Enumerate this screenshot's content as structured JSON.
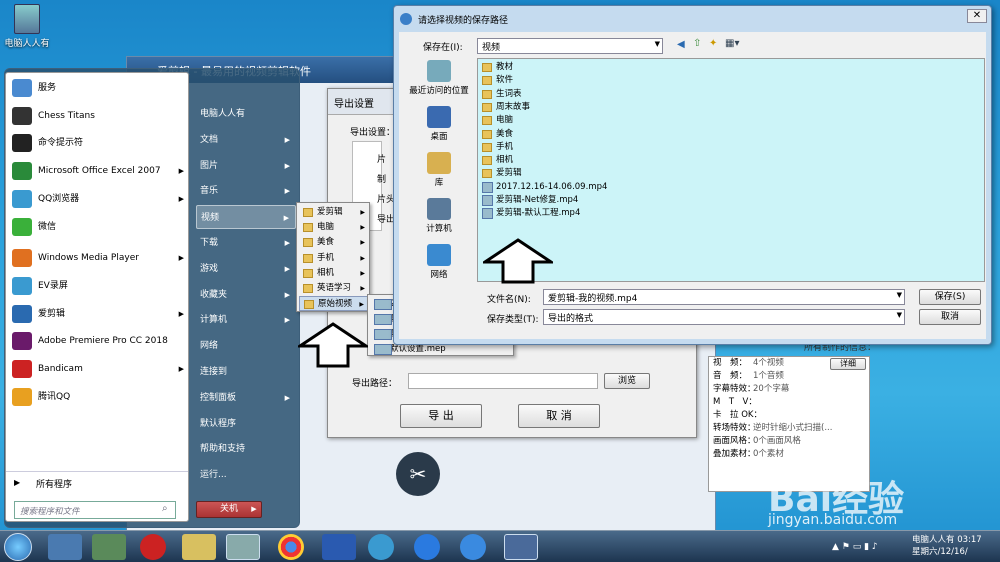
{
  "desktop": {
    "icon_label": "电脑人人有"
  },
  "bg_app": {
    "title": "爱剪辑 - 最易用的视频剪辑软件",
    "dialog_title": "导出设置",
    "export_settings_label": "导出设置：",
    "rows": [
      "片",
      "制",
      "片头",
      "导出"
    ],
    "export_path_label": "导出路径：",
    "browse": "浏览",
    "export_btn": "导 出",
    "cancel_btn": "取 消"
  },
  "info_panel": {
    "header": "所有制作的信息：",
    "rows": [
      [
        "视　频：",
        "4个视频"
      ],
      [
        "音　频：",
        "1个音频"
      ],
      [
        "字幕特效：",
        "20个字幕"
      ],
      [
        "M　T　V：",
        ""
      ],
      [
        "卡　拉 OK：",
        ""
      ],
      [
        "转场特效：",
        "逆时针缩小式扫描(..."
      ],
      [
        "画面风格：",
        "0个画面风格"
      ],
      [
        "叠加素材：",
        "0个素材"
      ]
    ],
    "detail_btn": "详细"
  },
  "start_menu": {
    "left_items": [
      {
        "label": "服务",
        "ar": false
      },
      {
        "label": "Chess Titans",
        "ar": false
      },
      {
        "label": "命令提示符",
        "ar": false
      },
      {
        "label": "Microsoft Office Excel 2007",
        "ar": true
      },
      {
        "label": "QQ浏览器",
        "ar": true
      },
      {
        "label": "微信",
        "ar": false
      },
      {
        "label": "Windows Media Player",
        "ar": true
      },
      {
        "label": "EV录屏",
        "ar": false
      },
      {
        "label": "爱剪辑",
        "ar": true
      },
      {
        "label": "Adobe Premiere Pro CC 2018",
        "ar": false
      },
      {
        "label": "Bandicam",
        "ar": true
      },
      {
        "label": "腾讯QQ",
        "ar": false
      }
    ],
    "all_programs": "所有程序",
    "search_placeholder": "搜索程序和文件",
    "right_items": [
      {
        "label": "电脑人人有",
        "ar": false
      },
      {
        "label": "文档",
        "ar": true
      },
      {
        "label": "图片",
        "ar": true
      },
      {
        "label": "音乐",
        "ar": true
      },
      {
        "label": "视频",
        "ar": true
      },
      {
        "label": "下载",
        "ar": true
      },
      {
        "label": "游戏",
        "ar": true
      },
      {
        "label": "收藏夹",
        "ar": true
      },
      {
        "label": "计算机",
        "ar": true
      },
      {
        "label": "网络",
        "ar": false
      },
      {
        "label": "连接到",
        "ar": false
      },
      {
        "label": "控制面板",
        "ar": true
      },
      {
        "label": "默认程序",
        "ar": false
      },
      {
        "label": "帮助和支持",
        "ar": false
      },
      {
        "label": "运行...",
        "ar": false
      }
    ],
    "shutdown": "关机"
  },
  "video_submenu": [
    {
      "label": "爱剪辑",
      "ar": true
    },
    {
      "label": "电脑",
      "ar": true
    },
    {
      "label": "美食",
      "ar": true
    },
    {
      "label": "手机",
      "ar": true
    },
    {
      "label": "相机",
      "ar": true
    },
    {
      "label": "英语学习",
      "ar": true
    },
    {
      "label": "原始视频",
      "ar": true
    }
  ],
  "raw_submenu": [
    "2017.12.16-14.06.09.mp4",
    "爱剪辑-Net修复.mp4",
    "爱剪辑-默认工程.mp4",
    "默认设置.mep"
  ],
  "save_dialog": {
    "title": "请选择视频的保存路径",
    "save_in_label": "保存在(I):",
    "save_in_value": "视频",
    "places": [
      "最近访问的位置",
      "桌面",
      "库",
      "计算机",
      "网络"
    ],
    "files": [
      {
        "name": "教材",
        "t": "folder"
      },
      {
        "name": "软件",
        "t": "folder"
      },
      {
        "name": "生词表",
        "t": "folder"
      },
      {
        "name": "周末故事",
        "t": "folder"
      },
      {
        "name": "电脑",
        "t": "folder"
      },
      {
        "name": "美食",
        "t": "folder"
      },
      {
        "name": "手机",
        "t": "folder"
      },
      {
        "name": "相机",
        "t": "folder"
      },
      {
        "name": "爱剪辑",
        "t": "folder"
      },
      {
        "name": "2017.12.16-14.06.09.mp4",
        "t": "mp4"
      },
      {
        "name": "爱剪辑-Net修复.mp4",
        "t": "mp4"
      },
      {
        "name": "爱剪辑-默认工程.mp4",
        "t": "mp4"
      }
    ],
    "filename_label": "文件名(N):",
    "filename_value": "爱剪辑-我的视频.mp4",
    "filetype_label": "保存类型(T):",
    "filetype_value": "导出的格式",
    "save_btn": "保存(S)",
    "cancel_btn": "取消"
  },
  "taskbar": {
    "time": "电脑人人有 03:17",
    "date": "星期六/12/16/"
  },
  "watermark": {
    "brand": "Bai经验",
    "url": "jingyan.baidu.com"
  }
}
